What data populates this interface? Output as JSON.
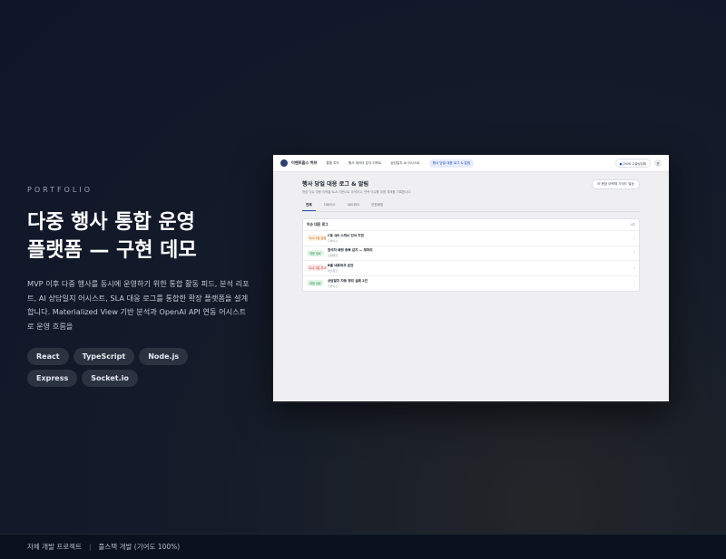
{
  "hero": {
    "eyebrow": "PORTFOLIO",
    "title_line1": "다중 행사 통합 운영",
    "title_line2": "플랫폼 — 구현 데모",
    "description": "MVP 이후 다중 행사를 동시에 운영하기 위한 통합 활동 피드, 분석 리포트, AI 상담일지 어시스트, SLA 대응 로그를 통합한 확장 플랫폼을 설계합니다. Materialized View 기반 분석과 OpenAI API 연동 어시스트로 운영 흐름을",
    "tags": [
      "React",
      "TypeScript",
      "Node.js",
      "Express",
      "Socket.io"
    ]
  },
  "footer": {
    "left": "자체 개발 프로젝트",
    "right": "풀스택 개발 (기여도 100%)"
  },
  "mock": {
    "nav": {
      "brand": "이벤트옵스 허브",
      "items": [
        "통합 피드",
        "행사 데이터 분석 리포트",
        "상담일지 AI 어시스트",
        "행사 당일 대응 로그 & 알림"
      ],
      "active_index": 3,
      "org_button": "2026 수출상담회",
      "avatar": "운"
    },
    "page_title": "행사 당일 대응 로그 & 알림",
    "page_subtitle": "현장 이슈 대응 이력을 SLA 기준으로 추적하고, 반복 이슈를 대응 체계를 기록합니다.",
    "action_button": "현장 이력체 가이드 발송",
    "tabs": [
      "전체",
      "디바이스",
      "네트워크",
      "인원배정"
    ],
    "active_tab": 0,
    "panel": {
      "title": "이슈 대응 로그",
      "count": "4건",
      "rows": [
        {
          "badge": "SLA 4분 남음",
          "badge_type": "warn",
          "title": "C동 QR 스캐너 인식 지연",
          "meta": "디바이스"
        },
        {
          "badge": "대응 완료",
          "badge_type": "ok",
          "title": "참석자 배정 중복 감지 — 재처리",
          "meta": "인원배정"
        },
        {
          "badge": "SLA 3분 초과",
          "badge_type": "danger",
          "title": "B홀 네트워크 순단",
          "meta": "네트워크"
        },
        {
          "badge": "대응 완료",
          "badge_type": "ok",
          "title": "상담일지 자동 정리 실패 2건",
          "meta": "디바이스"
        }
      ]
    }
  }
}
